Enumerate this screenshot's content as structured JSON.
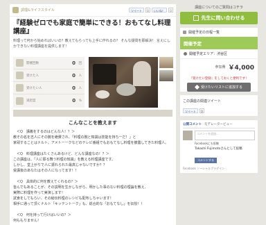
{
  "header": {
    "category": "調理&ライフスタイル",
    "tweet_label": "ツイート",
    "tweet_count": "0",
    "like_label": "いいね！",
    "like_count": "0"
  },
  "course": {
    "title": "『経験ゼロでも家庭で簡単にできる！おもてなし料理講座』",
    "lead": "料理って何から始めればいいの？教えてもらっても上手に作れるの？ そんな疑問を即解決！ 言えにしかできない料理講座を提供します！",
    "stats": [
      {
        "label": "開催回数",
        "value": "0",
        "unit": "回"
      },
      {
        "label": "受けた人",
        "value": "0",
        "unit": "人"
      },
      {
        "label": "受けたい人",
        "value": "0",
        "unit": "人"
      },
      {
        "label": "満足度",
        "value": "0",
        "unit": "%"
      }
    ]
  },
  "content": {
    "section_title": "こんなことを教えます",
    "body": "　＜Q　講義をするのはどんな人！？＞\n教その名を志人にその腕を絶賛され、「料理の腕と知識は技能を持ち一だ！」と\n家頑することはナルト。アメトーークなどのテレビ番組でもおもてなし料理を披露してきた料理人。\n\n　＜Q　料理講座はたくさんあるけど、どんな講座なの！？＞\nこの講座は、「人に振る舞う料理の知識」を教える料理講座です。\nしかし、堂上がりで人に振れられた最高じゃないですか？？\n受講後のあなたはその人になってます！！\n\n　＜Q　具体的に何を教えてくれるの？＞\n皆んでもあることが、その説明を生かしながら、明かした事のない料理の理論を教え、\n実際に料理を作って実演します！\n試食をしてもらい、その秘伝料理のレシピも配布しちゃいます！\n相手に通って頂くナルト「キッテントーク」も、総合的な「おもてなし」を伝授！！\n\n　＜Q　何を持って行けばいいの？＞\n何ももりません！"
  },
  "sidebar": {
    "help_text": "講座についてのご質問はコチラ",
    "contact_label": "先生に問い合わせる",
    "schedule_head": "開催予定の日程一覧",
    "status": "開催予定",
    "area": "開催予定エリア：渋谷区",
    "price_label": "参加費",
    "price": "￥4,000",
    "fav_note": "『受けたい登録』をしておくと便利です！",
    "fav_label": "受けたいリストに追加する",
    "tweets_head": "この講座の関連ツイート",
    "tweet_label": "ツイート",
    "tweet_count": "0",
    "fb_tab1": "公開コメント",
    "fb_tab2": "モデレータービュー",
    "fb_placeholder": "コメントを追加...",
    "fb_check": "Facebookにも投稿",
    "fb_user": "Takashi Fujimotoさんとして投稿",
    "fb_post": "コメントする",
    "fb_plugin": "Facebook ソーシャルプラグイン"
  }
}
